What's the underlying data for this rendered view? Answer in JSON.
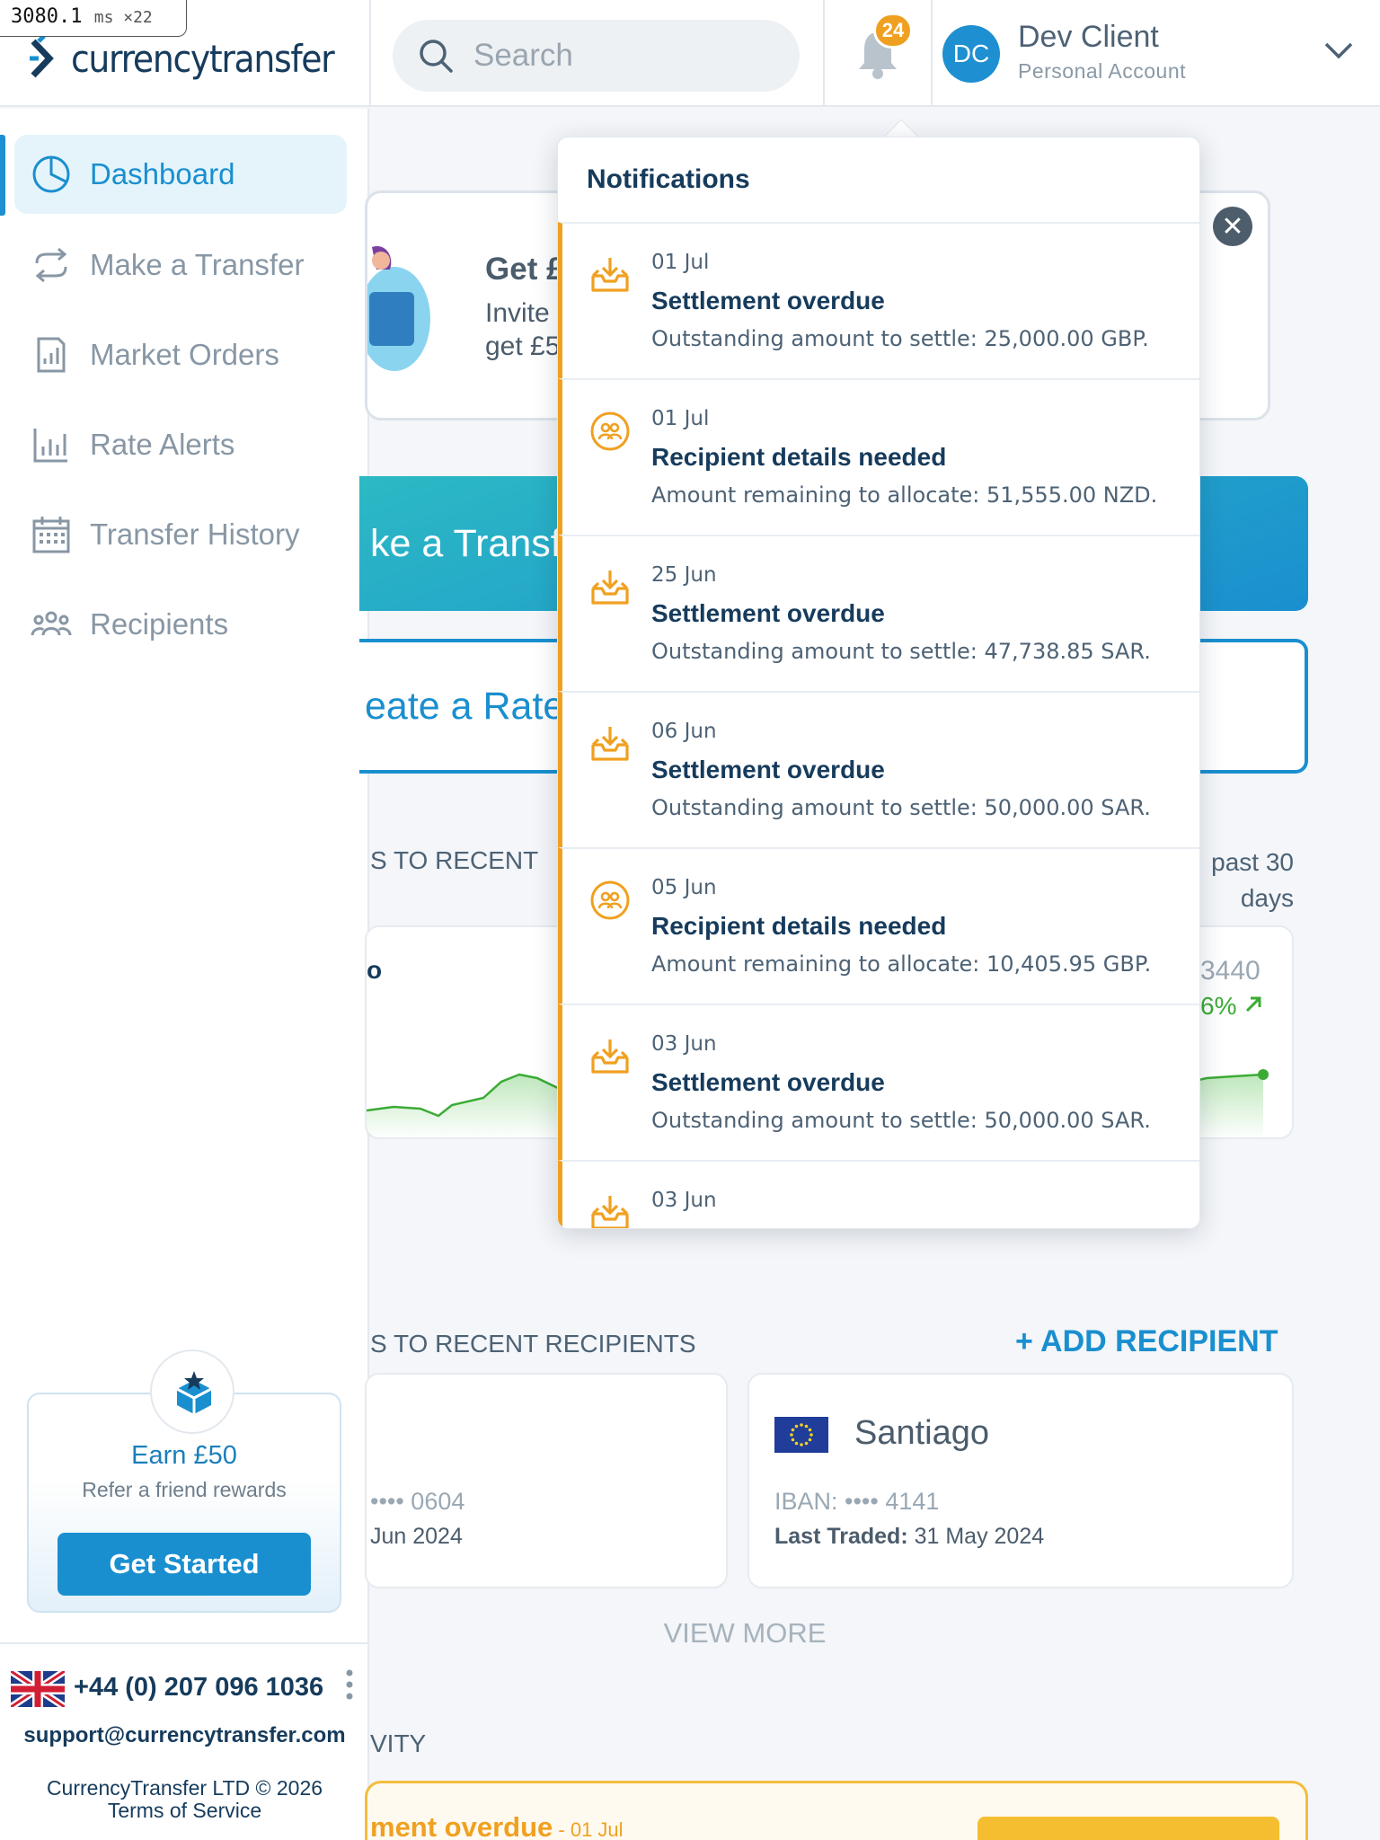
{
  "debug": {
    "value": "3080.1",
    "unit": "ms ×22"
  },
  "brand": {
    "name": "currencytransfer",
    "accent": "#1a8fcf",
    "warning": "#f0a020"
  },
  "header": {
    "search_placeholder": "Search",
    "notification_count": "24",
    "user": {
      "initials": "DC",
      "name": "Dev Client",
      "account_type": "Personal Account"
    }
  },
  "sidebar": {
    "items": [
      {
        "label": "Dashboard",
        "icon": "dashboard-icon",
        "active": true
      },
      {
        "label": "Make a Transfer",
        "icon": "transfer-arrows-icon",
        "active": false
      },
      {
        "label": "Market Orders",
        "icon": "market-orders-icon",
        "active": false
      },
      {
        "label": "Rate Alerts",
        "icon": "bar-chart-icon",
        "active": false
      },
      {
        "label": "Transfer History",
        "icon": "calendar-icon",
        "active": false
      },
      {
        "label": "Recipients",
        "icon": "people-icon",
        "active": false
      }
    ],
    "earn": {
      "title": "Earn £50",
      "subtitle": "Refer a friend rewards",
      "button": "Get Started"
    },
    "footer": {
      "phone": "+44 (0) 207 096 1036",
      "email": "support@currencytransfer.com",
      "copyright_line1": "CurrencyTransfer LTD © 2026",
      "copyright_line2": "Terms of Service"
    }
  },
  "main": {
    "promo": {
      "title": "Get £",
      "line1": "Invite",
      "line2": "get £5"
    },
    "make_transfer": "ke a Transfe",
    "rate_alert": "eate a Rate",
    "quick_heading": "S TO RECENT",
    "chart_period_line1": "past 30",
    "chart_period_line2": "days",
    "chart_rate": "3440",
    "chart_change": "6%",
    "chart_y_label": "o",
    "recipients_heading": "S TO RECENT RECIPIENTS",
    "add_recipient": "+ ADD RECIPIENT",
    "recipients": [
      {
        "name": "",
        "iban": "•••• 0604",
        "last_traded_label": "",
        "last_traded": "Jun 2024"
      },
      {
        "name": "Santiago",
        "iban": "IBAN: •••• 4141",
        "last_traded_label": "Last Traded:",
        "last_traded": " 31 May 2024"
      }
    ],
    "view_more": "VIEW MORE",
    "activity_heading": "VITY",
    "activity_title": "ment overdue",
    "activity_date": " - 01 Jul"
  },
  "notifications": {
    "title": "Notifications",
    "items": [
      {
        "date": "01 Jul",
        "title": "Settlement overdue",
        "desc": "Outstanding amount to settle: 25,000.00 GBP.",
        "icon": "inbox-download-icon"
      },
      {
        "date": "01 Jul",
        "title": "Recipient details needed",
        "desc": "Amount remaining to allocate: 51,555.00 NZD.",
        "icon": "recipients-circle-icon"
      },
      {
        "date": "25 Jun",
        "title": "Settlement overdue",
        "desc": "Outstanding amount to settle: 47,738.85 SAR.",
        "icon": "inbox-download-icon"
      },
      {
        "date": "06 Jun",
        "title": "Settlement overdue",
        "desc": "Outstanding amount to settle: 50,000.00 SAR.",
        "icon": "inbox-download-icon"
      },
      {
        "date": "05 Jun",
        "title": "Recipient details needed",
        "desc": "Amount remaining to allocate: 10,405.95 GBP.",
        "icon": "recipients-circle-icon"
      },
      {
        "date": "03 Jun",
        "title": "Settlement overdue",
        "desc": "Outstanding amount to settle: 50,000.00 SAR.",
        "icon": "inbox-download-icon"
      },
      {
        "date": "03 Jun",
        "title": "",
        "desc": "",
        "icon": "inbox-download-icon"
      }
    ]
  }
}
